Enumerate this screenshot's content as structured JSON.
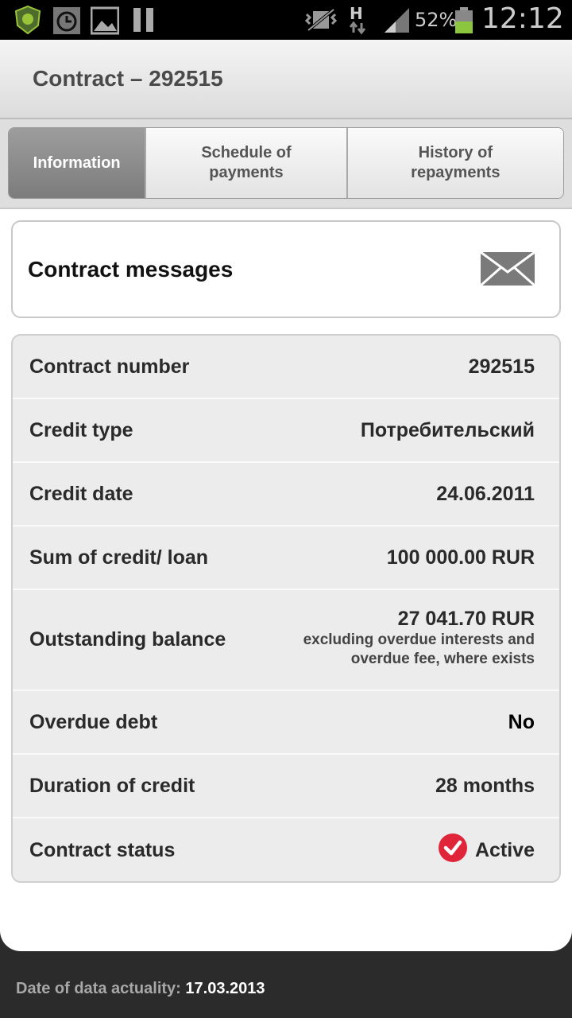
{
  "status_bar": {
    "battery_percent": "52%",
    "network": "H",
    "time": "12:12"
  },
  "header": {
    "title": "Contract – 292515"
  },
  "tabs": [
    {
      "label": "Information",
      "active": true
    },
    {
      "label": "Schedule of payments",
      "active": false
    },
    {
      "label": "History of repayments",
      "active": false
    }
  ],
  "messages": {
    "title": "Contract messages",
    "icon": "envelope-icon"
  },
  "info": {
    "contract_number": {
      "label": "Contract number",
      "value": "292515"
    },
    "credit_type": {
      "label": "Credit type",
      "value": "Потребительский"
    },
    "credit_date": {
      "label": "Credit date",
      "value": "24.06.2011"
    },
    "sum": {
      "label": "Sum of credit/ loan",
      "value": "100 000.00 RUR"
    },
    "balance": {
      "label": "Outstanding balance",
      "value": "27 041.70 RUR",
      "note": "excluding overdue interests and overdue fee, where exists"
    },
    "overdue": {
      "label": "Overdue debt",
      "value": "No"
    },
    "duration": {
      "label": "Duration of credit",
      "value": "28 months"
    },
    "status": {
      "label": "Contract status",
      "value": "Active",
      "icon": "check-circle-icon"
    }
  },
  "footer": {
    "label": "Date of data actuality:",
    "date": "17.03.2013"
  },
  "colors": {
    "accent": "#e0243a",
    "active_tab": "#8c8c8c",
    "battery": "#8cc63f"
  }
}
